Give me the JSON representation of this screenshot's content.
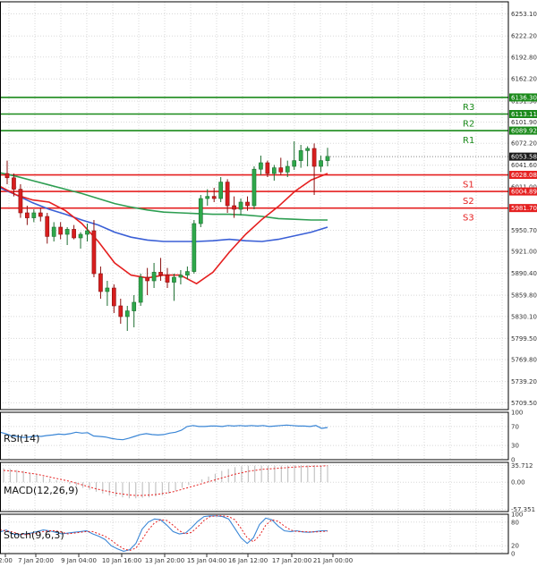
{
  "chart_data": {
    "type": "candlestick",
    "main": {
      "y_ticks": [
        "6253.10",
        "6222.20",
        "6192.80",
        "6162.20",
        "6131.30",
        "6101.90",
        "6072.20",
        "6041.60",
        "6011.00",
        "5981.90",
        "5950.70",
        "5921.00",
        "5890.40",
        "5859.80",
        "5830.10",
        "5799.50",
        "5769.80",
        "5739.20",
        "5709.50"
      ],
      "ylim": [
        5700,
        6270
      ],
      "current_price": "6053.58",
      "moving_averages": [
        {
          "color": "#2e9e52",
          "values": [
            6031,
            6026,
            6020,
            6014,
            6008,
            6002,
            5995,
            5988,
            5983,
            5979,
            5976,
            5975,
            5974,
            5973,
            5973,
            5972,
            5970,
            5967,
            5966,
            5965,
            5965
          ]
        },
        {
          "color": "#3a5fd6",
          "values": [
            6010,
            6000,
            5989,
            5980,
            5973,
            5965,
            5958,
            5948,
            5941,
            5937,
            5935,
            5935,
            5935,
            5936,
            5938,
            5936,
            5935,
            5938,
            5943,
            5948,
            5955
          ]
        },
        {
          "color": "#e52020",
          "values": [
            6012,
            6000,
            5993,
            5990,
            5978,
            5960,
            5935,
            5905,
            5888,
            5884,
            5888,
            5888,
            5876,
            5892,
            5920,
            5945,
            5966,
            5984,
            6005,
            6021,
            6030
          ]
        }
      ],
      "candles": [
        {
          "o": 6030,
          "h": 6048,
          "l": 6015,
          "c": 6024
        },
        {
          "o": 6024,
          "h": 6030,
          "l": 5998,
          "c": 6008
        },
        {
          "o": 6008,
          "h": 6015,
          "l": 5968,
          "c": 5975
        },
        {
          "o": 5975,
          "h": 5985,
          "l": 5958,
          "c": 5968
        },
        {
          "o": 5968,
          "h": 5980,
          "l": 5962,
          "c": 5975
        },
        {
          "o": 5975,
          "h": 5982,
          "l": 5963,
          "c": 5970
        },
        {
          "o": 5970,
          "h": 5975,
          "l": 5932,
          "c": 5942
        },
        {
          "o": 5942,
          "h": 5962,
          "l": 5935,
          "c": 5955
        },
        {
          "o": 5955,
          "h": 5962,
          "l": 5938,
          "c": 5945
        },
        {
          "o": 5945,
          "h": 5955,
          "l": 5930,
          "c": 5952
        },
        {
          "o": 5952,
          "h": 5958,
          "l": 5938,
          "c": 5940
        },
        {
          "o": 5940,
          "h": 5948,
          "l": 5925,
          "c": 5945
        },
        {
          "o": 5945,
          "h": 5960,
          "l": 5935,
          "c": 5950
        },
        {
          "o": 5950,
          "h": 5965,
          "l": 5885,
          "c": 5890
        },
        {
          "o": 5890,
          "h": 5900,
          "l": 5855,
          "c": 5865
        },
        {
          "o": 5865,
          "h": 5880,
          "l": 5845,
          "c": 5870
        },
        {
          "o": 5870,
          "h": 5875,
          "l": 5835,
          "c": 5845
        },
        {
          "o": 5845,
          "h": 5855,
          "l": 5820,
          "c": 5830
        },
        {
          "o": 5830,
          "h": 5845,
          "l": 5810,
          "c": 5838
        },
        {
          "o": 5838,
          "h": 5860,
          "l": 5815,
          "c": 5850
        },
        {
          "o": 5850,
          "h": 5890,
          "l": 5845,
          "c": 5885
        },
        {
          "o": 5885,
          "h": 5898,
          "l": 5860,
          "c": 5880
        },
        {
          "o": 5880,
          "h": 5905,
          "l": 5870,
          "c": 5892
        },
        {
          "o": 5892,
          "h": 5912,
          "l": 5880,
          "c": 5888
        },
        {
          "o": 5888,
          "h": 5898,
          "l": 5870,
          "c": 5878
        },
        {
          "o": 5878,
          "h": 5890,
          "l": 5852,
          "c": 5885
        },
        {
          "o": 5885,
          "h": 5895,
          "l": 5875,
          "c": 5888
        },
        {
          "o": 5888,
          "h": 5900,
          "l": 5882,
          "c": 5893
        },
        {
          "o": 5893,
          "h": 5965,
          "l": 5890,
          "c": 5960
        },
        {
          "o": 5960,
          "h": 6000,
          "l": 5955,
          "c": 5995
        },
        {
          "o": 5995,
          "h": 6008,
          "l": 5985,
          "c": 5998
        },
        {
          "o": 5998,
          "h": 6010,
          "l": 5990,
          "c": 5995
        },
        {
          "o": 5995,
          "h": 6025,
          "l": 5990,
          "c": 6018
        },
        {
          "o": 6018,
          "h": 6022,
          "l": 5975,
          "c": 5985
        },
        {
          "o": 5985,
          "h": 5998,
          "l": 5968,
          "c": 5980
        },
        {
          "o": 5980,
          "h": 5995,
          "l": 5972,
          "c": 5990
        },
        {
          "o": 5990,
          "h": 5998,
          "l": 5978,
          "c": 5985
        },
        {
          "o": 5985,
          "h": 6040,
          "l": 5980,
          "c": 6036
        },
        {
          "o": 6036,
          "h": 6055,
          "l": 6028,
          "c": 6045
        },
        {
          "o": 6045,
          "h": 6048,
          "l": 6025,
          "c": 6030
        },
        {
          "o": 6030,
          "h": 6042,
          "l": 6020,
          "c": 6038
        },
        {
          "o": 6038,
          "h": 6052,
          "l": 6028,
          "c": 6032
        },
        {
          "o": 6032,
          "h": 6048,
          "l": 6025,
          "c": 6040
        },
        {
          "o": 6040,
          "h": 6075,
          "l": 6035,
          "c": 6048
        },
        {
          "o": 6048,
          "h": 6070,
          "l": 6038,
          "c": 6062
        },
        {
          "o": 6062,
          "h": 6068,
          "l": 6040,
          "c": 6065
        },
        {
          "o": 6065,
          "h": 6072,
          "l": 6000,
          "c": 6040
        },
        {
          "o": 6040,
          "h": 6055,
          "l": 6032,
          "c": 6048
        },
        {
          "o": 6048,
          "h": 6066,
          "l": 6040,
          "c": 6054
        }
      ],
      "levels": [
        {
          "name": "R3",
          "value": 6136.3,
          "tag": "6136.30",
          "color": "#1a8a1a"
        },
        {
          "name": "R2",
          "value": 6113.11,
          "tag": "6113.11",
          "color": "#1a8a1a"
        },
        {
          "name": "R1",
          "value": 6089.92,
          "tag": "6089.92",
          "color": "#1a8a1a"
        },
        {
          "name": "S1",
          "value": 6028.08,
          "tag": "6028.08",
          "color": "#e52020"
        },
        {
          "name": "S2",
          "value": 6004.89,
          "tag": "6004.89",
          "color": "#e52020"
        },
        {
          "name": "S3",
          "value": 5981.7,
          "tag": "5981.70",
          "color": "#e52020"
        }
      ],
      "x_ticks": [
        "2:00",
        "7 Jan 20:00",
        "9 Jan 04:00",
        "10 Jan 16:00",
        "13 Jan 20:00",
        "15 Jan 04:00",
        "16 Jan 12:00",
        "17 Jan 20:00",
        "21 Jan 00:00"
      ]
    },
    "rsi": {
      "label": "RSI(14)",
      "y_ticks": [
        "100",
        "70",
        "30",
        "0"
      ],
      "ylim": [
        0,
        100
      ],
      "color": "#3a86d6",
      "values": [
        58,
        55,
        50,
        49,
        47,
        48,
        50,
        49,
        51,
        52,
        54,
        53,
        55,
        58,
        56,
        57,
        50,
        49,
        48,
        45,
        43,
        42,
        45,
        49,
        53,
        55,
        53,
        52,
        53,
        56,
        58,
        62,
        70,
        72,
        70,
        70,
        71,
        71,
        70,
        72,
        71,
        72,
        71,
        72,
        71,
        72,
        70,
        71,
        72,
        73,
        72,
        71,
        71,
        70,
        72,
        66,
        68
      ]
    },
    "macd": {
      "label": "MACD(12,26,9)",
      "y_ticks": [
        "35.712",
        "0.00",
        "-57.351"
      ],
      "ylim": [
        -62,
        42
      ],
      "signal_color": "#e52020",
      "signal": [
        25,
        24,
        23,
        21,
        19,
        17,
        14,
        11,
        8,
        5,
        2,
        -2,
        -6,
        -10,
        -14,
        -17,
        -20,
        -23,
        -25,
        -27,
        -28,
        -28,
        -27,
        -26,
        -24,
        -22,
        -19,
        -15,
        -11,
        -7,
        -3,
        1,
        5,
        9,
        13,
        17,
        20,
        23,
        25,
        27,
        28,
        29,
        30,
        31,
        32,
        33,
        33,
        34,
        34,
        35
      ],
      "histogram": [
        30,
        28,
        26,
        24,
        20,
        16,
        12,
        8,
        4,
        0,
        -4,
        -8,
        -12,
        -16,
        -20,
        -24,
        -28,
        -30,
        -32,
        -34,
        -34,
        -33,
        -32,
        -30,
        -28,
        -24,
        -18,
        -12,
        -6,
        0,
        6,
        12,
        18,
        24,
        28,
        32,
        34,
        35,
        35,
        35,
        35,
        35,
        35,
        35,
        36,
        36,
        36,
        36,
        35,
        35
      ]
    },
    "stoch": {
      "label": "Stoch(9,6,3)",
      "y_ticks": [
        "100",
        "80",
        "20",
        "0"
      ],
      "ylim": [
        0,
        100
      ],
      "k_color": "#3a86d6",
      "d_color": "#e52020",
      "k": [
        55,
        60,
        50,
        48,
        50,
        52,
        56,
        60,
        58,
        54,
        50,
        52,
        54,
        56,
        58,
        50,
        44,
        36,
        20,
        12,
        6,
        10,
        26,
        62,
        80,
        88,
        86,
        72,
        56,
        50,
        52,
        66,
        82,
        94,
        96,
        96,
        94,
        88,
        64,
        40,
        26,
        40,
        74,
        90,
        86,
        70,
        58,
        56,
        58,
        55,
        54,
        56,
        58,
        58
      ],
      "d": [
        60,
        58,
        55,
        50,
        48,
        50,
        52,
        56,
        58,
        58,
        54,
        50,
        52,
        54,
        56,
        56,
        50,
        44,
        34,
        22,
        12,
        8,
        14,
        36,
        60,
        78,
        86,
        84,
        72,
        58,
        50,
        54,
        68,
        84,
        94,
        96,
        96,
        94,
        86,
        64,
        40,
        30,
        46,
        72,
        86,
        82,
        70,
        60,
        56,
        56,
        55,
        55,
        56,
        57
      ]
    }
  }
}
